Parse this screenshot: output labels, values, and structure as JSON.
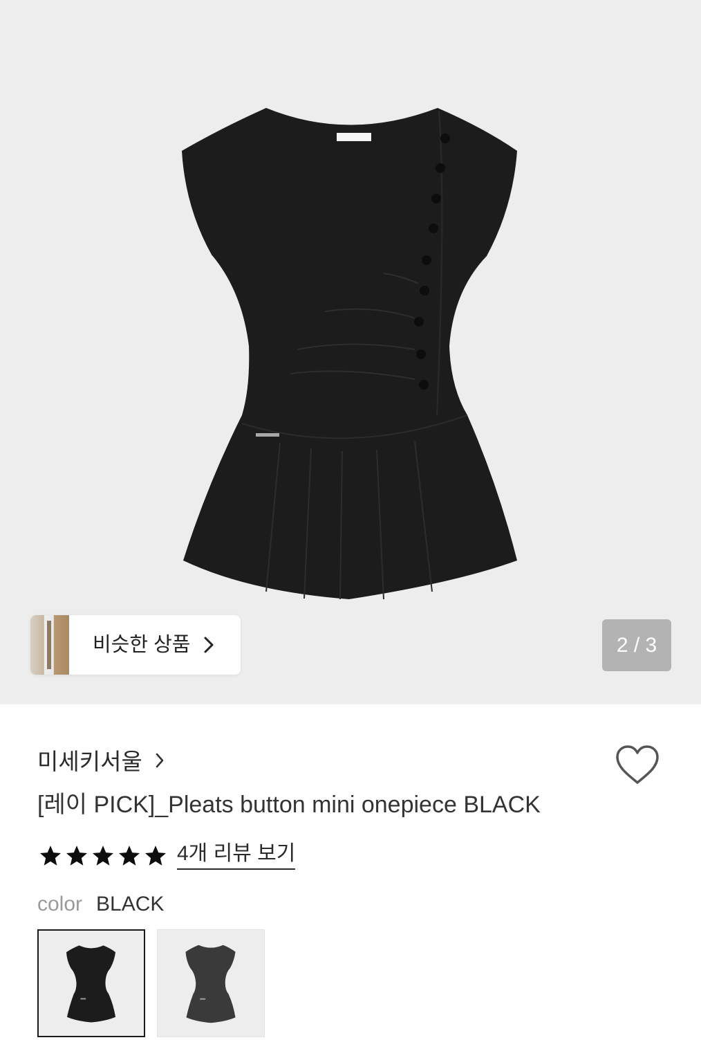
{
  "gallery": {
    "similar_label": "비슷한 상품",
    "page_counter": "2 / 3"
  },
  "product": {
    "brand": "미세키서울",
    "title": "[레이 PICK]_Pleats button mini onepiece BLACK",
    "rating": 5,
    "rating_max": 5,
    "review_link": "4개 리뷰 보기"
  },
  "options": {
    "color_label": "color",
    "color_value": "BLACK"
  },
  "colors": {
    "hero_bg": "#ededed",
    "counter_bg": "#b3b3b3",
    "dress_black": "#1c1c1c",
    "dress_charcoal": "#3a3a3a"
  },
  "icons": [
    "chevron-right-icon",
    "heart-outline-icon",
    "star-filled-icon"
  ]
}
